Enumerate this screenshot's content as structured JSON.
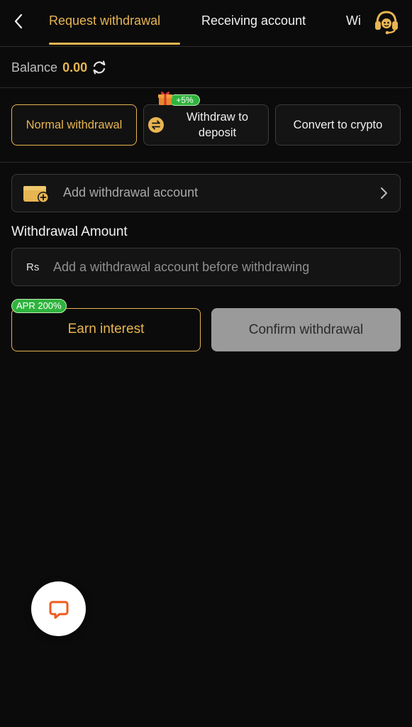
{
  "header": {
    "tabs": [
      {
        "label": "Request withdrawal",
        "active": true
      },
      {
        "label": "Receiving account",
        "active": false
      },
      {
        "label": "Wi",
        "active": false
      }
    ]
  },
  "balance": {
    "label": "Balance",
    "value": "0.00"
  },
  "methods": {
    "normal": "Normal withdrawal",
    "to_deposit": "Withdraw to deposit",
    "to_deposit_badge": "+5%",
    "crypto": "Convert to crypto"
  },
  "account": {
    "add_label": "Add withdrawal account"
  },
  "amount": {
    "title": "Withdrawal Amount",
    "currency": "Rs",
    "placeholder": "Add a withdrawal account before withdrawing"
  },
  "actions": {
    "apr_badge": "APR 200%",
    "earn_label": "Earn interest",
    "confirm_label": "Confirm withdrawal"
  },
  "colors": {
    "accent": "#e7b552",
    "background": "#0b0b0b",
    "badge_green": "#2fb33d",
    "disabled_button": "#9a9a9a",
    "chat_icon": "#f05a1a"
  },
  "icons": {
    "back": "chevron-left-icon",
    "support": "headset-icon",
    "refresh": "refresh-icon",
    "swap": "swap-icon",
    "gift": "gift-icon",
    "wallet": "wallet-add-icon",
    "chevron": "chevron-right-icon",
    "chat": "chat-icon"
  }
}
